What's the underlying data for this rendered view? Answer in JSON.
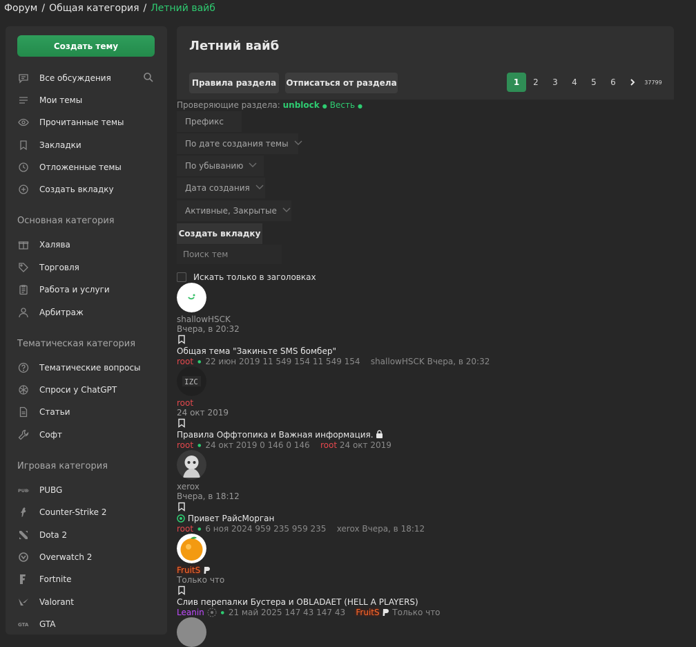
{
  "breadcrumb": {
    "items": [
      "Форум",
      "Общая категория"
    ],
    "current": "Летний вайб"
  },
  "sidebar": {
    "create_button": "Создать тему",
    "nav": [
      {
        "label": "Все обсуждения",
        "icon": "chat-icon"
      },
      {
        "label": "Мои темы",
        "icon": "list-icon"
      },
      {
        "label": "Прочитанные темы",
        "icon": "eye-icon"
      },
      {
        "label": "Закладки",
        "icon": "bookmark-icon"
      },
      {
        "label": "Отложенные темы",
        "icon": "clock-icon"
      },
      {
        "label": "Создать вкладку",
        "icon": "plus-circle-icon"
      }
    ],
    "sections": [
      {
        "title": "Основная категория",
        "items": [
          {
            "label": "Халява",
            "icon": "gift-icon"
          },
          {
            "label": "Торговля",
            "icon": "tag-icon"
          },
          {
            "label": "Работа и услуги",
            "icon": "clipboard-icon"
          },
          {
            "label": "Арбитраж",
            "icon": "user-icon"
          }
        ]
      },
      {
        "title": "Тематическая категория",
        "items": [
          {
            "label": "Тематические вопросы",
            "icon": "question-icon"
          },
          {
            "label": "Спроси у ChatGPT",
            "icon": "chatgpt-icon"
          },
          {
            "label": "Статьи",
            "icon": "document-icon"
          },
          {
            "label": "Софт",
            "icon": "wrench-icon"
          }
        ]
      },
      {
        "title": "Игровая категория",
        "items": [
          {
            "label": "PUBG",
            "icon": "pubg-icon"
          },
          {
            "label": "Counter-Strike 2",
            "icon": "counter-strike-icon"
          },
          {
            "label": "Dota 2",
            "icon": "dota-icon"
          },
          {
            "label": "Overwatch 2",
            "icon": "overwatch-icon"
          },
          {
            "label": "Fortnite",
            "icon": "fortnite-icon"
          },
          {
            "label": "Valorant",
            "icon": "valorant-icon"
          },
          {
            "label": "GTA",
            "icon": "gta-icon"
          }
        ]
      }
    ]
  },
  "forum": {
    "title": "Летний вайб",
    "rules_button": "Правила раздела",
    "unsubscribe_button": "Отписаться от раздела",
    "pages": [
      "1",
      "2",
      "3",
      "4",
      "5",
      "6"
    ],
    "last_page": "37799",
    "active_page": "1",
    "reviewers_label": "Проверяющие раздела:",
    "reviewers": [
      "unblock",
      "Весть"
    ]
  },
  "filters": {
    "prefix": "Префикс",
    "sort": "По дате создания темы",
    "order": "По убыванию",
    "date": "Дата создания",
    "state": "Активные, Закрытые",
    "create_tab": "Создать вкладку",
    "search_placeholder": "Поиск тем",
    "titles_only": "Искать только в заголовках"
  },
  "threads": [
    {
      "author": "shallowHSCK",
      "time": "Вчера, в 20:32",
      "title": "Общая тема \"Закиньте SMS бомбер\"",
      "starter": "root",
      "created": "22 июн 2019",
      "stats": "11 549 154 11 549 154",
      "last_user": "shallowHSCK",
      "last_time": "Вчера, в 20:32"
    },
    {
      "author": "root",
      "time": "24 окт 2019",
      "title": "Правила Оффтопика и Важная информация.",
      "starter": "root",
      "created": "24 окт 2019",
      "stats": "0 146 0 146",
      "last_user": "root",
      "last_time": "24 окт 2019"
    },
    {
      "author": "xerox",
      "time": "Вчера, в 18:12",
      "title": "Привет РайсМорган",
      "starter": "root",
      "created": "6 ноя 2024",
      "stats": "959 235 959 235",
      "last_user": "xerox",
      "last_time": "Вчера, в 18:12"
    },
    {
      "author": "FruitS",
      "time": "Только что",
      "title": "Слив перепалки Бустера и OBLADAET (HELL A PLAYERS)",
      "starter": "Leanin",
      "created": "21 май 2025",
      "stats": "147 43 147 43",
      "last_user": "FruitS",
      "last_time": "Только что"
    }
  ]
}
